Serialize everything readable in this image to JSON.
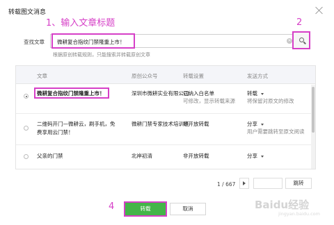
{
  "dialog": {
    "title": "转载图文消息"
  },
  "annotations": {
    "step1": "1、输入文章标题",
    "step2": "2",
    "step3": "3",
    "step4": "4"
  },
  "search": {
    "label": "查找文章",
    "value": "微耕复合指纹门禁隆重上市！",
    "hint": "根据原创转载规则，只能搜索并转载原创文章"
  },
  "table": {
    "headers": [
      "文章",
      "原创公众号",
      "转载设置",
      "发送方式"
    ],
    "rows": [
      {
        "selected": true,
        "title": "微耕复合指纹门禁隆重上市！",
        "account": "深圳市微耕实业有限公司",
        "setting": "已纳入白名单",
        "setting_note": "可修改，显示转载来源",
        "send": "转载",
        "send_note": "将保留对原文的修改"
      },
      {
        "selected": false,
        "title": "二维码开门—微耕云，刷手机，免费享用云门禁！",
        "account": "微耕门禁专家技术培训班",
        "setting": "非开放转载",
        "setting_note": "",
        "send": "分享",
        "send_note": "用户需要跳转至原文阅读"
      },
      {
        "selected": false,
        "title": "父亲的门禁",
        "account": "北岸初清",
        "setting": "非开放转载",
        "setting_note": "",
        "send": "分享",
        "send_note": ""
      }
    ]
  },
  "pagination": {
    "current": "1 / 667",
    "go_label": "跳转"
  },
  "buttons": {
    "send": "转载",
    "cancel": "取消"
  },
  "watermark": {
    "text": "Baidu经验",
    "sub": "jingyan.baidu.com"
  },
  "colors": {
    "accent_annotation": "#d63fc7",
    "primary_button": "#44b549"
  }
}
